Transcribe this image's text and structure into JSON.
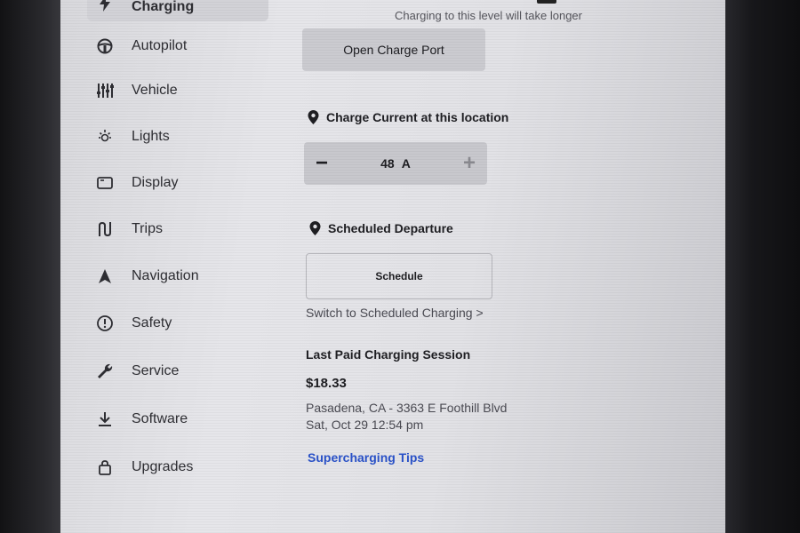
{
  "sidebar": {
    "items": [
      {
        "label": "Charging",
        "icon": "bolt-icon"
      },
      {
        "label": "Autopilot",
        "icon": "steering-wheel-icon"
      },
      {
        "label": "Vehicle",
        "icon": "sliders-icon"
      },
      {
        "label": "Lights",
        "icon": "sun-icon"
      },
      {
        "label": "Display",
        "icon": "display-icon"
      },
      {
        "label": "Trips",
        "icon": "trips-icon"
      },
      {
        "label": "Navigation",
        "icon": "navigation-arrow-icon"
      },
      {
        "label": "Safety",
        "icon": "alert-circle-icon"
      },
      {
        "label": "Service",
        "icon": "wrench-icon"
      },
      {
        "label": "Software",
        "icon": "download-icon"
      },
      {
        "label": "Upgrades",
        "icon": "bag-icon"
      }
    ]
  },
  "charging": {
    "hint": "Charging to this level will take longer",
    "open_port_label": "Open Charge Port",
    "current_label": "Charge Current at this location",
    "current_value": "48",
    "current_unit": "A",
    "minus_symbol": "−",
    "plus_symbol": "+",
    "departure_label": "Scheduled Departure",
    "schedule_button": "Schedule",
    "switch_link": "Switch to Scheduled Charging >",
    "session_title": "Last Paid Charging Session",
    "session_price": "$18.33",
    "session_location": "Pasadena, CA - 3363 E Foothill Blvd",
    "session_date": "Sat, Oct 29 12:54 pm",
    "tips_link": "Supercharging Tips"
  },
  "colors": {
    "accent_link": "#2a52c9",
    "screen_bg": "#e2e2e6"
  }
}
